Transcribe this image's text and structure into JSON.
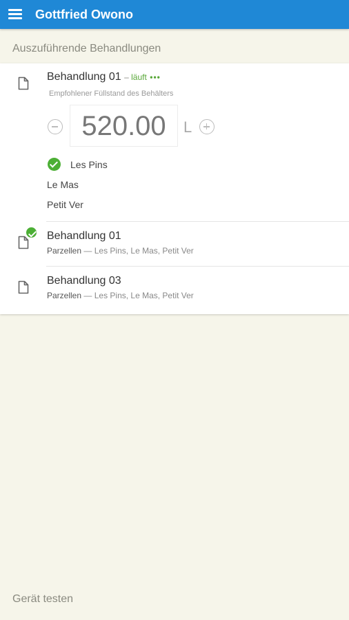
{
  "appbar": {
    "title": "Gottfried Owono"
  },
  "section": {
    "title": "Auszuführende Behandlungen"
  },
  "treatments": [
    {
      "title": "Behandlung 01",
      "status_dash": "–",
      "status": "läuft",
      "status_dots": "•••",
      "hint": "Empfohlener Füllstand des Behälters",
      "tank_value": "520.00",
      "unit": "L",
      "plots": [
        {
          "name": "Les Pins",
          "done": true
        },
        {
          "name": "Le Mas",
          "done": false
        },
        {
          "name": "Petit Ver",
          "done": false
        }
      ]
    },
    {
      "title": "Behandlung 01",
      "sub_label": "Parzellen",
      "sub_sep": "—",
      "sub_plots": "Les Pins, Le Mas, Petit Ver",
      "done": true
    },
    {
      "title": "Behandlung 03",
      "sub_label": "Parzellen",
      "sub_sep": "—",
      "sub_plots": "Les Pins, Le Mas, Petit Ver",
      "done": false
    }
  ],
  "footer": {
    "link": "Gerät testen"
  },
  "colors": {
    "primary": "#1f88d6",
    "success": "#4caf35",
    "background": "#f6f5ea"
  }
}
